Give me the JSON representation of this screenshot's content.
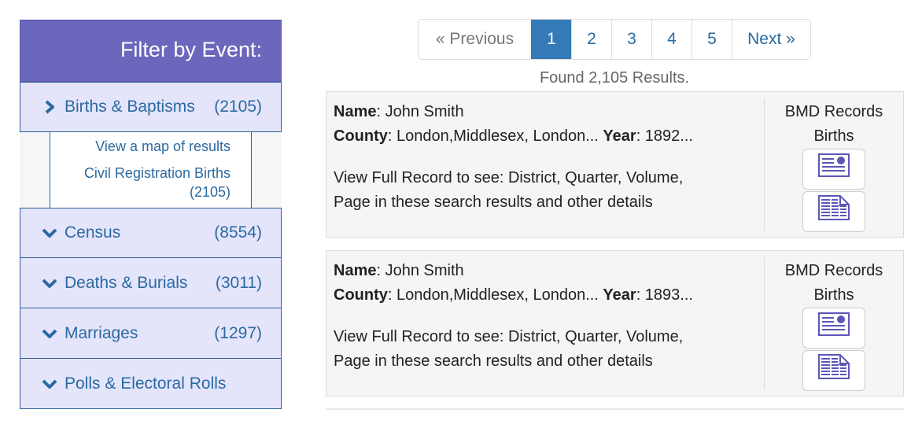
{
  "sidebar": {
    "title": "Filter by Event:",
    "events": [
      {
        "label": "Births & Baptisms",
        "count": "(2105)",
        "icon": "chevron-right-icon",
        "expanded": true
      },
      {
        "label": "Census",
        "count": "(8554)",
        "icon": "chevron-down-icon",
        "expanded": false
      },
      {
        "label": "Deaths & Burials",
        "count": "(3011)",
        "icon": "chevron-down-icon",
        "expanded": false
      },
      {
        "label": "Marriages",
        "count": "(1297)",
        "icon": "chevron-down-icon",
        "expanded": false
      },
      {
        "label": "Polls & Electoral Rolls",
        "count": "",
        "icon": "chevron-down-icon",
        "expanded": false
      }
    ],
    "births_subpanel": {
      "map_link": "View a map of results",
      "civil_link": "Civil Registration Births",
      "civil_count": "(2105)"
    }
  },
  "pagination": {
    "previous": "« Previous",
    "pages": [
      "1",
      "2",
      "3",
      "4",
      "5"
    ],
    "active_page": "1",
    "next": "Next »"
  },
  "results_summary": "Found 2,105 Results.",
  "colors": {
    "header_bg": "#6b67bc",
    "event_bg": "#e4e4fb",
    "link": "#2b6aa0",
    "active_page": "#337ab7",
    "icon": "#5b57b8"
  },
  "results": [
    {
      "name_label": "Name",
      "name": ": John Smith",
      "county_label": "County",
      "county": ": London,Middlesex, London... ",
      "year_label": "Year",
      "year": ": 1892...",
      "desc_line1": "View Full Record to see: District, Quarter, Volume,",
      "desc_line2": "Page in these search results and other details",
      "source": "BMD Records",
      "type": "Births",
      "buttons": [
        "certificate-icon",
        "transcript-icon"
      ]
    },
    {
      "name_label": "Name",
      "name": ": John Smith",
      "county_label": "County",
      "county": ": London,Middlesex, London... ",
      "year_label": "Year",
      "year": ": 1893...",
      "desc_line1": "View Full Record to see: District, Quarter, Volume,",
      "desc_line2": "Page in these search results and other details",
      "source": "BMD Records",
      "type": "Births",
      "buttons": [
        "certificate-icon",
        "transcript-icon"
      ]
    }
  ]
}
